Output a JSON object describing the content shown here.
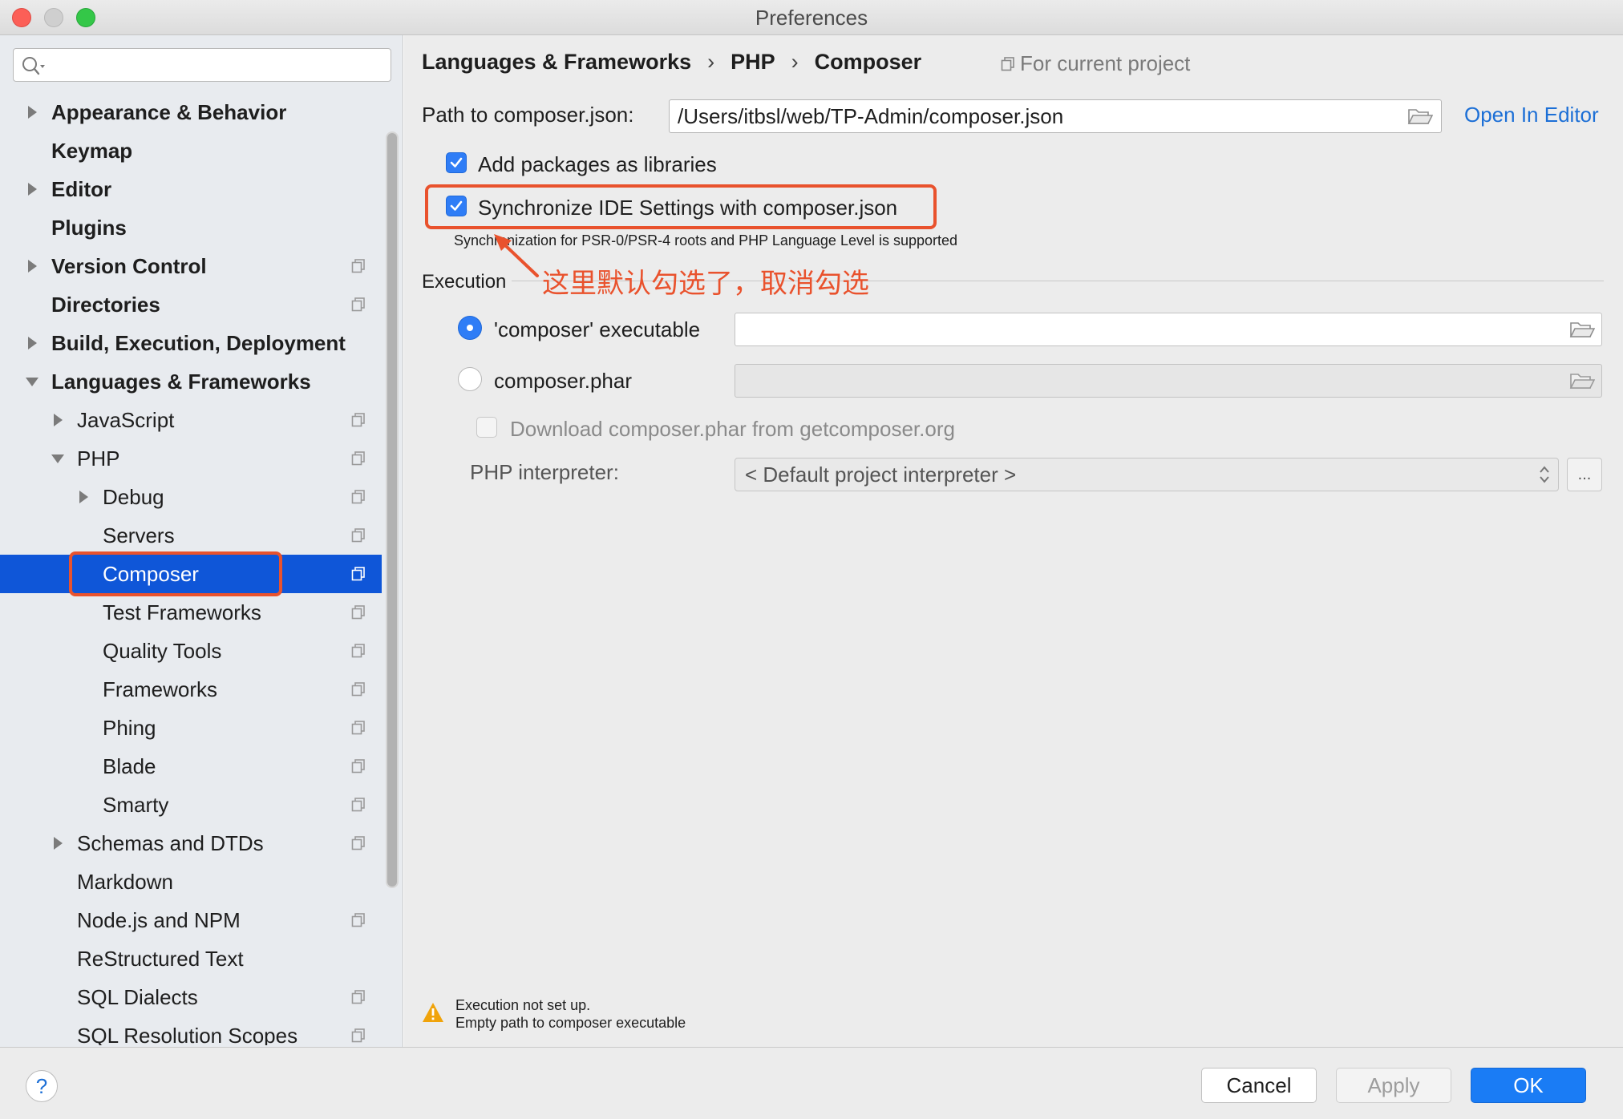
{
  "window": {
    "title": "Preferences"
  },
  "sidebar": {
    "search_placeholder": "",
    "items": [
      {
        "label": "Appearance & Behavior",
        "level": 0,
        "bold": true,
        "expander": "collapsed",
        "project_icon": false,
        "selected": false
      },
      {
        "label": "Keymap",
        "level": 0,
        "bold": true,
        "expander": "none",
        "project_icon": false,
        "selected": false
      },
      {
        "label": "Editor",
        "level": 0,
        "bold": true,
        "expander": "collapsed",
        "project_icon": false,
        "selected": false
      },
      {
        "label": "Plugins",
        "level": 0,
        "bold": true,
        "expander": "none",
        "project_icon": false,
        "selected": false
      },
      {
        "label": "Version Control",
        "level": 0,
        "bold": true,
        "expander": "collapsed",
        "project_icon": true,
        "selected": false
      },
      {
        "label": "Directories",
        "level": 0,
        "bold": true,
        "expander": "none",
        "project_icon": true,
        "selected": false
      },
      {
        "label": "Build, Execution, Deployment",
        "level": 0,
        "bold": true,
        "expander": "collapsed",
        "project_icon": false,
        "selected": false
      },
      {
        "label": "Languages & Frameworks",
        "level": 0,
        "bold": true,
        "expander": "expanded",
        "project_icon": false,
        "selected": false
      },
      {
        "label": "JavaScript",
        "level": 1,
        "bold": false,
        "expander": "collapsed",
        "project_icon": true,
        "selected": false
      },
      {
        "label": "PHP",
        "level": 1,
        "bold": false,
        "expander": "expanded",
        "project_icon": true,
        "selected": false
      },
      {
        "label": "Debug",
        "level": 2,
        "bold": false,
        "expander": "collapsed",
        "project_icon": true,
        "selected": false
      },
      {
        "label": "Servers",
        "level": 2,
        "bold": false,
        "expander": "none",
        "project_icon": true,
        "selected": false
      },
      {
        "label": "Composer",
        "level": 2,
        "bold": false,
        "expander": "none",
        "project_icon": true,
        "selected": true
      },
      {
        "label": "Test Frameworks",
        "level": 2,
        "bold": false,
        "expander": "none",
        "project_icon": true,
        "selected": false
      },
      {
        "label": "Quality Tools",
        "level": 2,
        "bold": false,
        "expander": "none",
        "project_icon": true,
        "selected": false
      },
      {
        "label": "Frameworks",
        "level": 2,
        "bold": false,
        "expander": "none",
        "project_icon": true,
        "selected": false
      },
      {
        "label": "Phing",
        "level": 2,
        "bold": false,
        "expander": "none",
        "project_icon": true,
        "selected": false
      },
      {
        "label": "Blade",
        "level": 2,
        "bold": false,
        "expander": "none",
        "project_icon": true,
        "selected": false
      },
      {
        "label": "Smarty",
        "level": 2,
        "bold": false,
        "expander": "none",
        "project_icon": true,
        "selected": false
      },
      {
        "label": "Schemas and DTDs",
        "level": 1,
        "bold": false,
        "expander": "collapsed",
        "project_icon": true,
        "selected": false
      },
      {
        "label": "Markdown",
        "level": 1,
        "bold": false,
        "expander": "none",
        "project_icon": false,
        "selected": false
      },
      {
        "label": "Node.js and NPM",
        "level": 1,
        "bold": false,
        "expander": "none",
        "project_icon": true,
        "selected": false
      },
      {
        "label": "ReStructured Text",
        "level": 1,
        "bold": false,
        "expander": "none",
        "project_icon": false,
        "selected": false
      },
      {
        "label": "SQL Dialects",
        "level": 1,
        "bold": false,
        "expander": "none",
        "project_icon": true,
        "selected": false
      },
      {
        "label": "SQL Resolution Scopes",
        "level": 1,
        "bold": false,
        "expander": "none",
        "project_icon": true,
        "selected": false
      }
    ]
  },
  "main": {
    "breadcrumb": [
      "Languages & Frameworks",
      "PHP",
      "Composer"
    ],
    "breadcrumb_separator": "›",
    "scope_hint": "For current project",
    "path_label": "Path to composer.json:",
    "path_value": "/Users/itbsl/web/TP-Admin/composer.json",
    "open_in_editor": "Open In Editor",
    "add_packages_label": "Add packages as libraries",
    "add_packages_checked": true,
    "sync_label": "Synchronize IDE Settings with composer.json",
    "sync_checked": true,
    "sync_hint": "Synchronization for PSR-0/PSR-4 roots and PHP Language Level is supported",
    "execution_title": "Execution",
    "exec_option_label": "'composer' executable",
    "exec_option_selected": true,
    "exec_path": "",
    "phar_option_label": "composer.phar",
    "phar_option_selected": false,
    "phar_path": "",
    "download_label": "Download composer.phar from getcomposer.org",
    "download_checked": false,
    "interpreter_label": "PHP interpreter:",
    "interpreter_value": "< Default project interpreter >",
    "ellipsis": "...",
    "warning_line1": "Execution not set up.",
    "warning_line2": "Empty path to composer executable"
  },
  "annotation": {
    "text": "这里默认勾选了，取消勾选",
    "color": "#e9522d"
  },
  "footer": {
    "help": "?",
    "cancel": "Cancel",
    "apply": "Apply",
    "ok": "OK"
  },
  "colors": {
    "selection": "#0f56d8",
    "accent": "#2f7df6",
    "link": "#1c6fd6",
    "annotation": "#e9522d",
    "warning": "#f0a30a"
  }
}
